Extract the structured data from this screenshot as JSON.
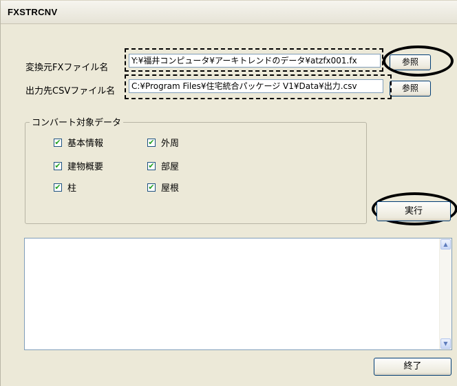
{
  "window": {
    "title": "FXSTRCNV"
  },
  "source": {
    "label": "変換元FXファイル名",
    "path": "Y:¥福井コンピュータ¥アーキトレンドのデータ¥atzfx001.fx",
    "browse_label": "参照"
  },
  "output": {
    "label": "出力先CSVファイル名",
    "path": "C:¥Program Files¥住宅統合パッケージ V1¥Data¥出力.csv",
    "browse_label": "参照"
  },
  "convert_group": {
    "title": "コンバート対象データ",
    "items": [
      {
        "label": "基本情報",
        "checked": true
      },
      {
        "label": "外周",
        "checked": true
      },
      {
        "label": "建物概要",
        "checked": true
      },
      {
        "label": "部屋",
        "checked": true
      },
      {
        "label": "柱",
        "checked": true
      },
      {
        "label": "屋根",
        "checked": true
      }
    ]
  },
  "execute_label": "実行",
  "log": {
    "text": ""
  },
  "exit_label": "終了",
  "scroll_icons": {
    "up": "scroll-up-arrow",
    "down": "scroll-down-arrow"
  },
  "colors": {
    "window_bg": "#ece9d8",
    "border": "#7f9db9",
    "check": "#21a121"
  }
}
